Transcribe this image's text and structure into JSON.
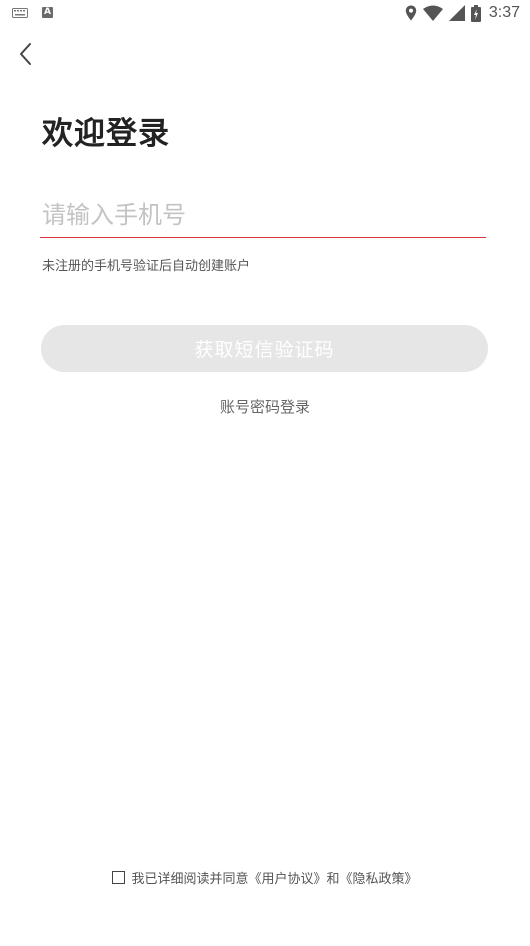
{
  "status_bar": {
    "time": "3:37",
    "left_icons": [
      "keyboard-icon",
      "a-icon"
    ],
    "right_icons": [
      "location-icon",
      "wifi-icon",
      "signal-icon",
      "battery-icon"
    ],
    "a_icon_letter": "A"
  },
  "nav": {
    "back_icon": "chevron-left-icon"
  },
  "login": {
    "title": "欢迎登录",
    "phone_placeholder": "请输入手机号",
    "phone_value": "",
    "hint": "未注册的手机号验证后自动创建账户",
    "sms_button_label": "获取短信验证码",
    "password_login_link": "账号密码登录"
  },
  "agreement": {
    "checked": false,
    "prefix": "我已详细阅读并同意",
    "user_agreement": "《用户协议》",
    "and": "和",
    "privacy_policy": "《隐私政策》"
  },
  "colors": {
    "accent_underline": "#d9363e",
    "button_disabled_bg": "#e6e6e6",
    "placeholder": "#c3c3c3"
  }
}
